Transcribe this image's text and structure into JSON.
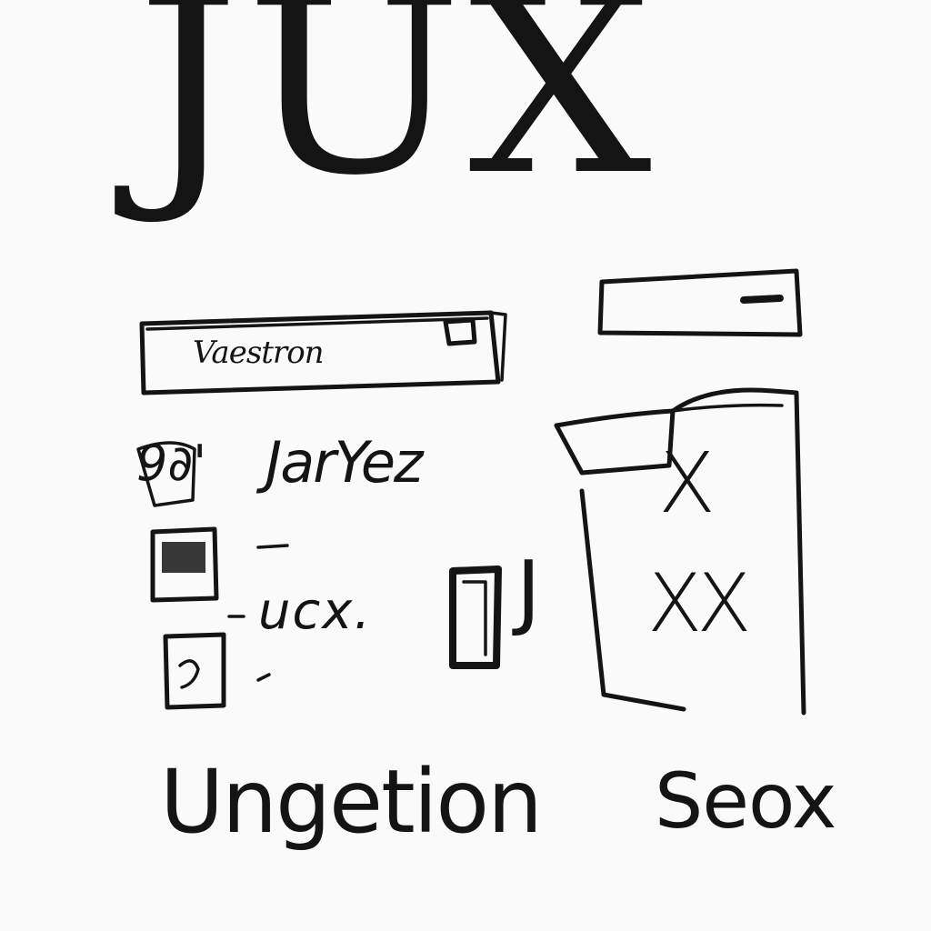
{
  "title": "JUX",
  "text_field": {
    "value": "Vaestron"
  },
  "list": {
    "mark_glyph": "9∂'",
    "items": [
      {
        "label": "JarYez",
        "checked": false
      },
      {
        "label": "ucx.",
        "checked": true
      },
      {
        "label": "",
        "checked": false
      }
    ],
    "j_glyph": "J"
  },
  "panel": {
    "entries": [
      "X",
      "XX"
    ]
  },
  "footer": {
    "left_label": "Ungetion",
    "right_label": "Seox"
  },
  "colors": {
    "ink": "#141414",
    "paper": "#fafafa"
  }
}
